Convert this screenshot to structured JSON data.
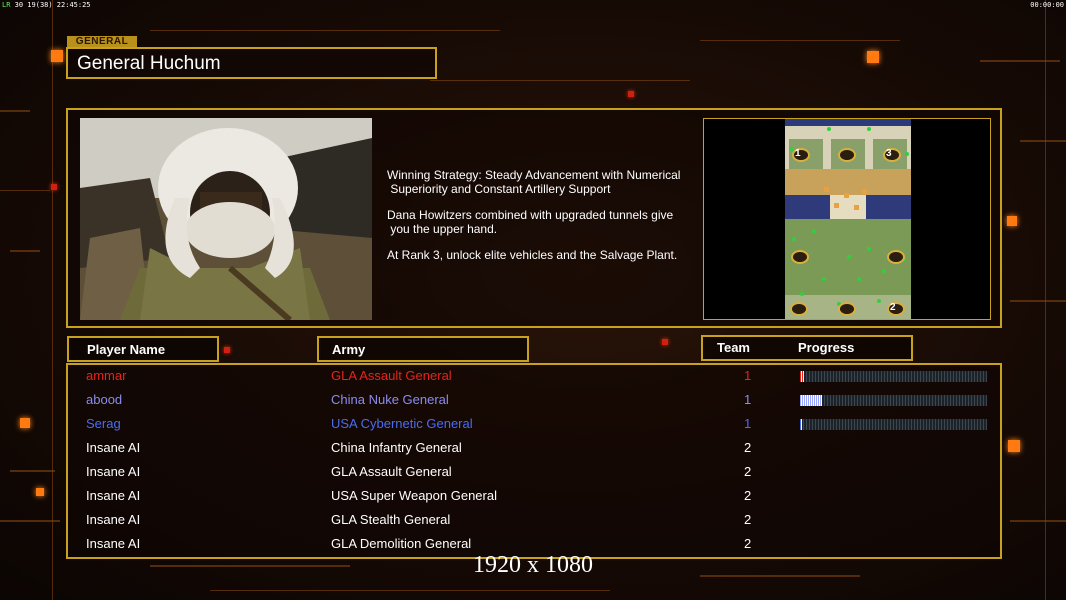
{
  "hud": {
    "left_text": "30 19(38) 22:45:25",
    "left_prefix": "LR",
    "right_text": "00:00:00"
  },
  "general": {
    "tag": "GENERAL",
    "name": "General Huchum"
  },
  "description": [
    "Winning Strategy: Steady Advancement with Numerical\n Superiority and Constant Artillery Support",
    "Dana Howitzers combined with upgraded tunnels give\n you the upper hand.",
    "At Rank 3, unlock elite vehicles and the Salvage Plant."
  ],
  "map": {
    "markers": [
      "1",
      "3",
      "2"
    ]
  },
  "headers": {
    "player": "Player Name",
    "army": "Army",
    "team": "Team",
    "progress": "Progress"
  },
  "players": [
    {
      "name": "ammar",
      "army": "GLA Assault General",
      "team": "1",
      "color": "#e8231a",
      "progress": 0.02,
      "bar_color": "#e8231a"
    },
    {
      "name": "abood",
      "army": "China Nuke General",
      "team": "1",
      "color": "#8a8cf0",
      "progress": 0.12,
      "bar_color": "#9aa6ff"
    },
    {
      "name": "Serag",
      "army": "USA Cybernetic General",
      "team": "1",
      "color": "#4a6cf2",
      "progress": 0.01,
      "bar_color": "#4a6cf2"
    },
    {
      "name": "Insane AI",
      "army": "China Infantry General",
      "team": "2",
      "color": "#ffffff"
    },
    {
      "name": "Insane AI",
      "army": "GLA Assault General",
      "team": "2",
      "color": "#ffffff"
    },
    {
      "name": "Insane AI",
      "army": "USA Super Weapon General",
      "team": "2",
      "color": "#ffffff"
    },
    {
      "name": "Insane AI",
      "army": "GLA Stealth General",
      "team": "2",
      "color": "#ffffff"
    },
    {
      "name": "Insane AI",
      "army": "GLA Demolition General",
      "team": "2",
      "color": "#ffffff"
    }
  ],
  "resolution": "1920 x 1080",
  "colors": {
    "frame": "#c8a21c",
    "accent": "#ff7a10"
  }
}
